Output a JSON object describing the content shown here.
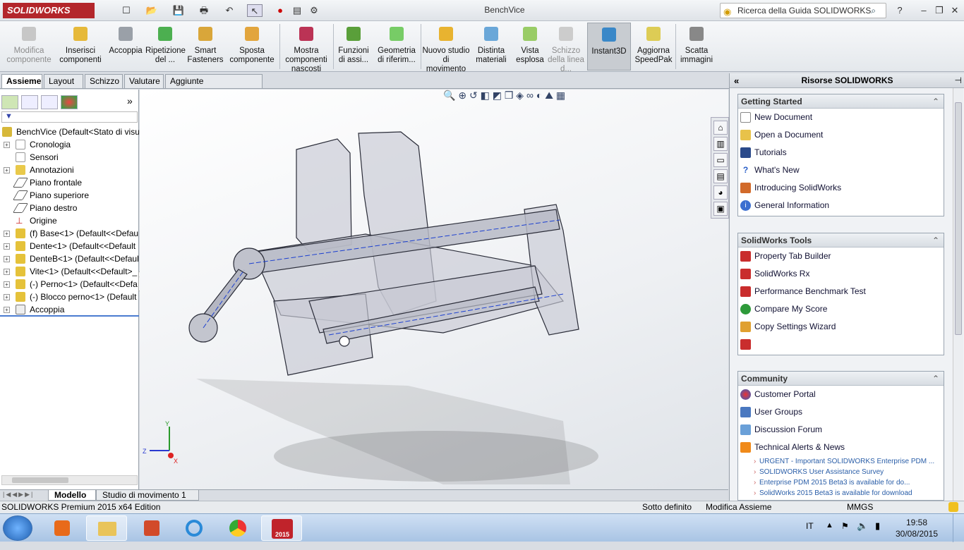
{
  "app": {
    "logo": "SOLIDWORKS",
    "document_title": "BenchVice"
  },
  "titlebar": {
    "help_search_placeholder": "Ricerca della Guida SOLIDWORKS",
    "icons": [
      "new-icon",
      "open-icon",
      "save-icon",
      "print-icon",
      "undo-icon",
      "select-icon",
      "rebuild-icon",
      "options-icon",
      "help-icon",
      "minimize-icon",
      "restore-icon",
      "close-icon"
    ]
  },
  "ribbon": [
    {
      "label": "Modifica componente",
      "dim": true
    },
    {
      "label": "Inserisci componenti"
    },
    {
      "label": "Accoppia"
    },
    {
      "label": "Ripetizione del ..."
    },
    {
      "label": "Smart Fasteners"
    },
    {
      "label": "Sposta componente"
    },
    {
      "label": "Mostra componenti nascosti"
    },
    {
      "label": "Funzioni di assi..."
    },
    {
      "label": "Geometria di riferim..."
    },
    {
      "label": "Nuovo studio di movimento"
    },
    {
      "label": "Distinta materiali"
    },
    {
      "label": "Vista esplosa"
    },
    {
      "label": "Schizzo della linea d...",
      "dim": true
    },
    {
      "label": "Instant3D",
      "active": true
    },
    {
      "label": "Aggiorna SpeedPak"
    },
    {
      "label": "Scatta immagini"
    }
  ],
  "tabs": [
    "Assieme",
    "Layout",
    "Schizzo",
    "Valutare",
    "Aggiunte SOLIDWORKS"
  ],
  "tree": [
    {
      "label": "BenchVice  (Default<Stato di visu",
      "icon": "assembly-icon",
      "expand": false,
      "root": true
    },
    {
      "label": "Cronologia",
      "icon": "history-icon",
      "expand": true
    },
    {
      "label": "Sensori",
      "icon": "sensor-icon",
      "expand": false
    },
    {
      "label": "Annotazioni",
      "icon": "annotation-icon",
      "expand": true
    },
    {
      "label": "Piano frontale",
      "icon": "plane-icon",
      "expand": false
    },
    {
      "label": "Piano superiore",
      "icon": "plane-icon",
      "expand": false
    },
    {
      "label": "Piano destro",
      "icon": "plane-icon",
      "expand": false
    },
    {
      "label": "Origine",
      "icon": "origin-icon",
      "expand": false
    },
    {
      "label": "(f) Base<1> (Default<<Defau",
      "icon": "part-icon",
      "expand": true
    },
    {
      "label": "Dente<1> (Default<<Default",
      "icon": "part-icon",
      "expand": true
    },
    {
      "label": "DenteB<1> (Default<<Default",
      "icon": "part-icon",
      "expand": true
    },
    {
      "label": "Vite<1> (Default<<Default>_",
      "icon": "part-icon",
      "expand": true
    },
    {
      "label": "(-) Perno<1> (Default<<Defa",
      "icon": "part-icon",
      "expand": true
    },
    {
      "label": "(-) Blocco perno<1> (Default",
      "icon": "part-icon",
      "expand": true
    },
    {
      "label": "Accoppia",
      "icon": "mate-icon",
      "expand": true
    }
  ],
  "viewport": {
    "axes": {
      "x": "X",
      "y": "Y",
      "z": "Z"
    }
  },
  "right_panel": {
    "title": "Risorse SOLIDWORKS",
    "sections": [
      {
        "title": "Getting Started",
        "items": [
          "New Document",
          "Open a Document",
          "Tutorials",
          "What's New",
          "Introducing SolidWorks",
          "General Information"
        ]
      },
      {
        "title": "SolidWorks Tools",
        "items": [
          "Property Tab Builder",
          "SolidWorks Rx",
          "Performance Benchmark Test",
          "Compare My Score",
          "Copy Settings Wizard",
          ""
        ]
      },
      {
        "title": "Community",
        "items": [
          "Customer Portal",
          "User Groups",
          "Discussion Forum",
          "Technical Alerts & News"
        ],
        "news": [
          "URGENT - Important SOLIDWORKS Enterprise PDM ...",
          "SOLIDWORKS User Assistance Survey",
          "Enterprise PDM 2015 Beta3 is available for do...",
          "SolidWorks 2015 Beta3 is available for download"
        ]
      }
    ]
  },
  "bottom_tabs": [
    "Modello",
    "Studio di movimento 1"
  ],
  "status": {
    "edition": "SOLIDWORKS Premium 2015 x64 Edition",
    "state": "Sotto definito",
    "mode": "Modifica Assieme",
    "units": "MMGS"
  },
  "taskbar": {
    "lang": "IT",
    "time": "19:58",
    "date": "30/08/2015",
    "apps": [
      "explorer-icon",
      "media-player-icon",
      "office-icon",
      "internet-explorer-icon",
      "chrome-icon",
      "solidworks-icon"
    ],
    "sw_badge": "2015"
  },
  "colors": {
    "accent": "#b3262b",
    "tree_select": "#4a7bd0",
    "link": "#2a5ea8"
  }
}
